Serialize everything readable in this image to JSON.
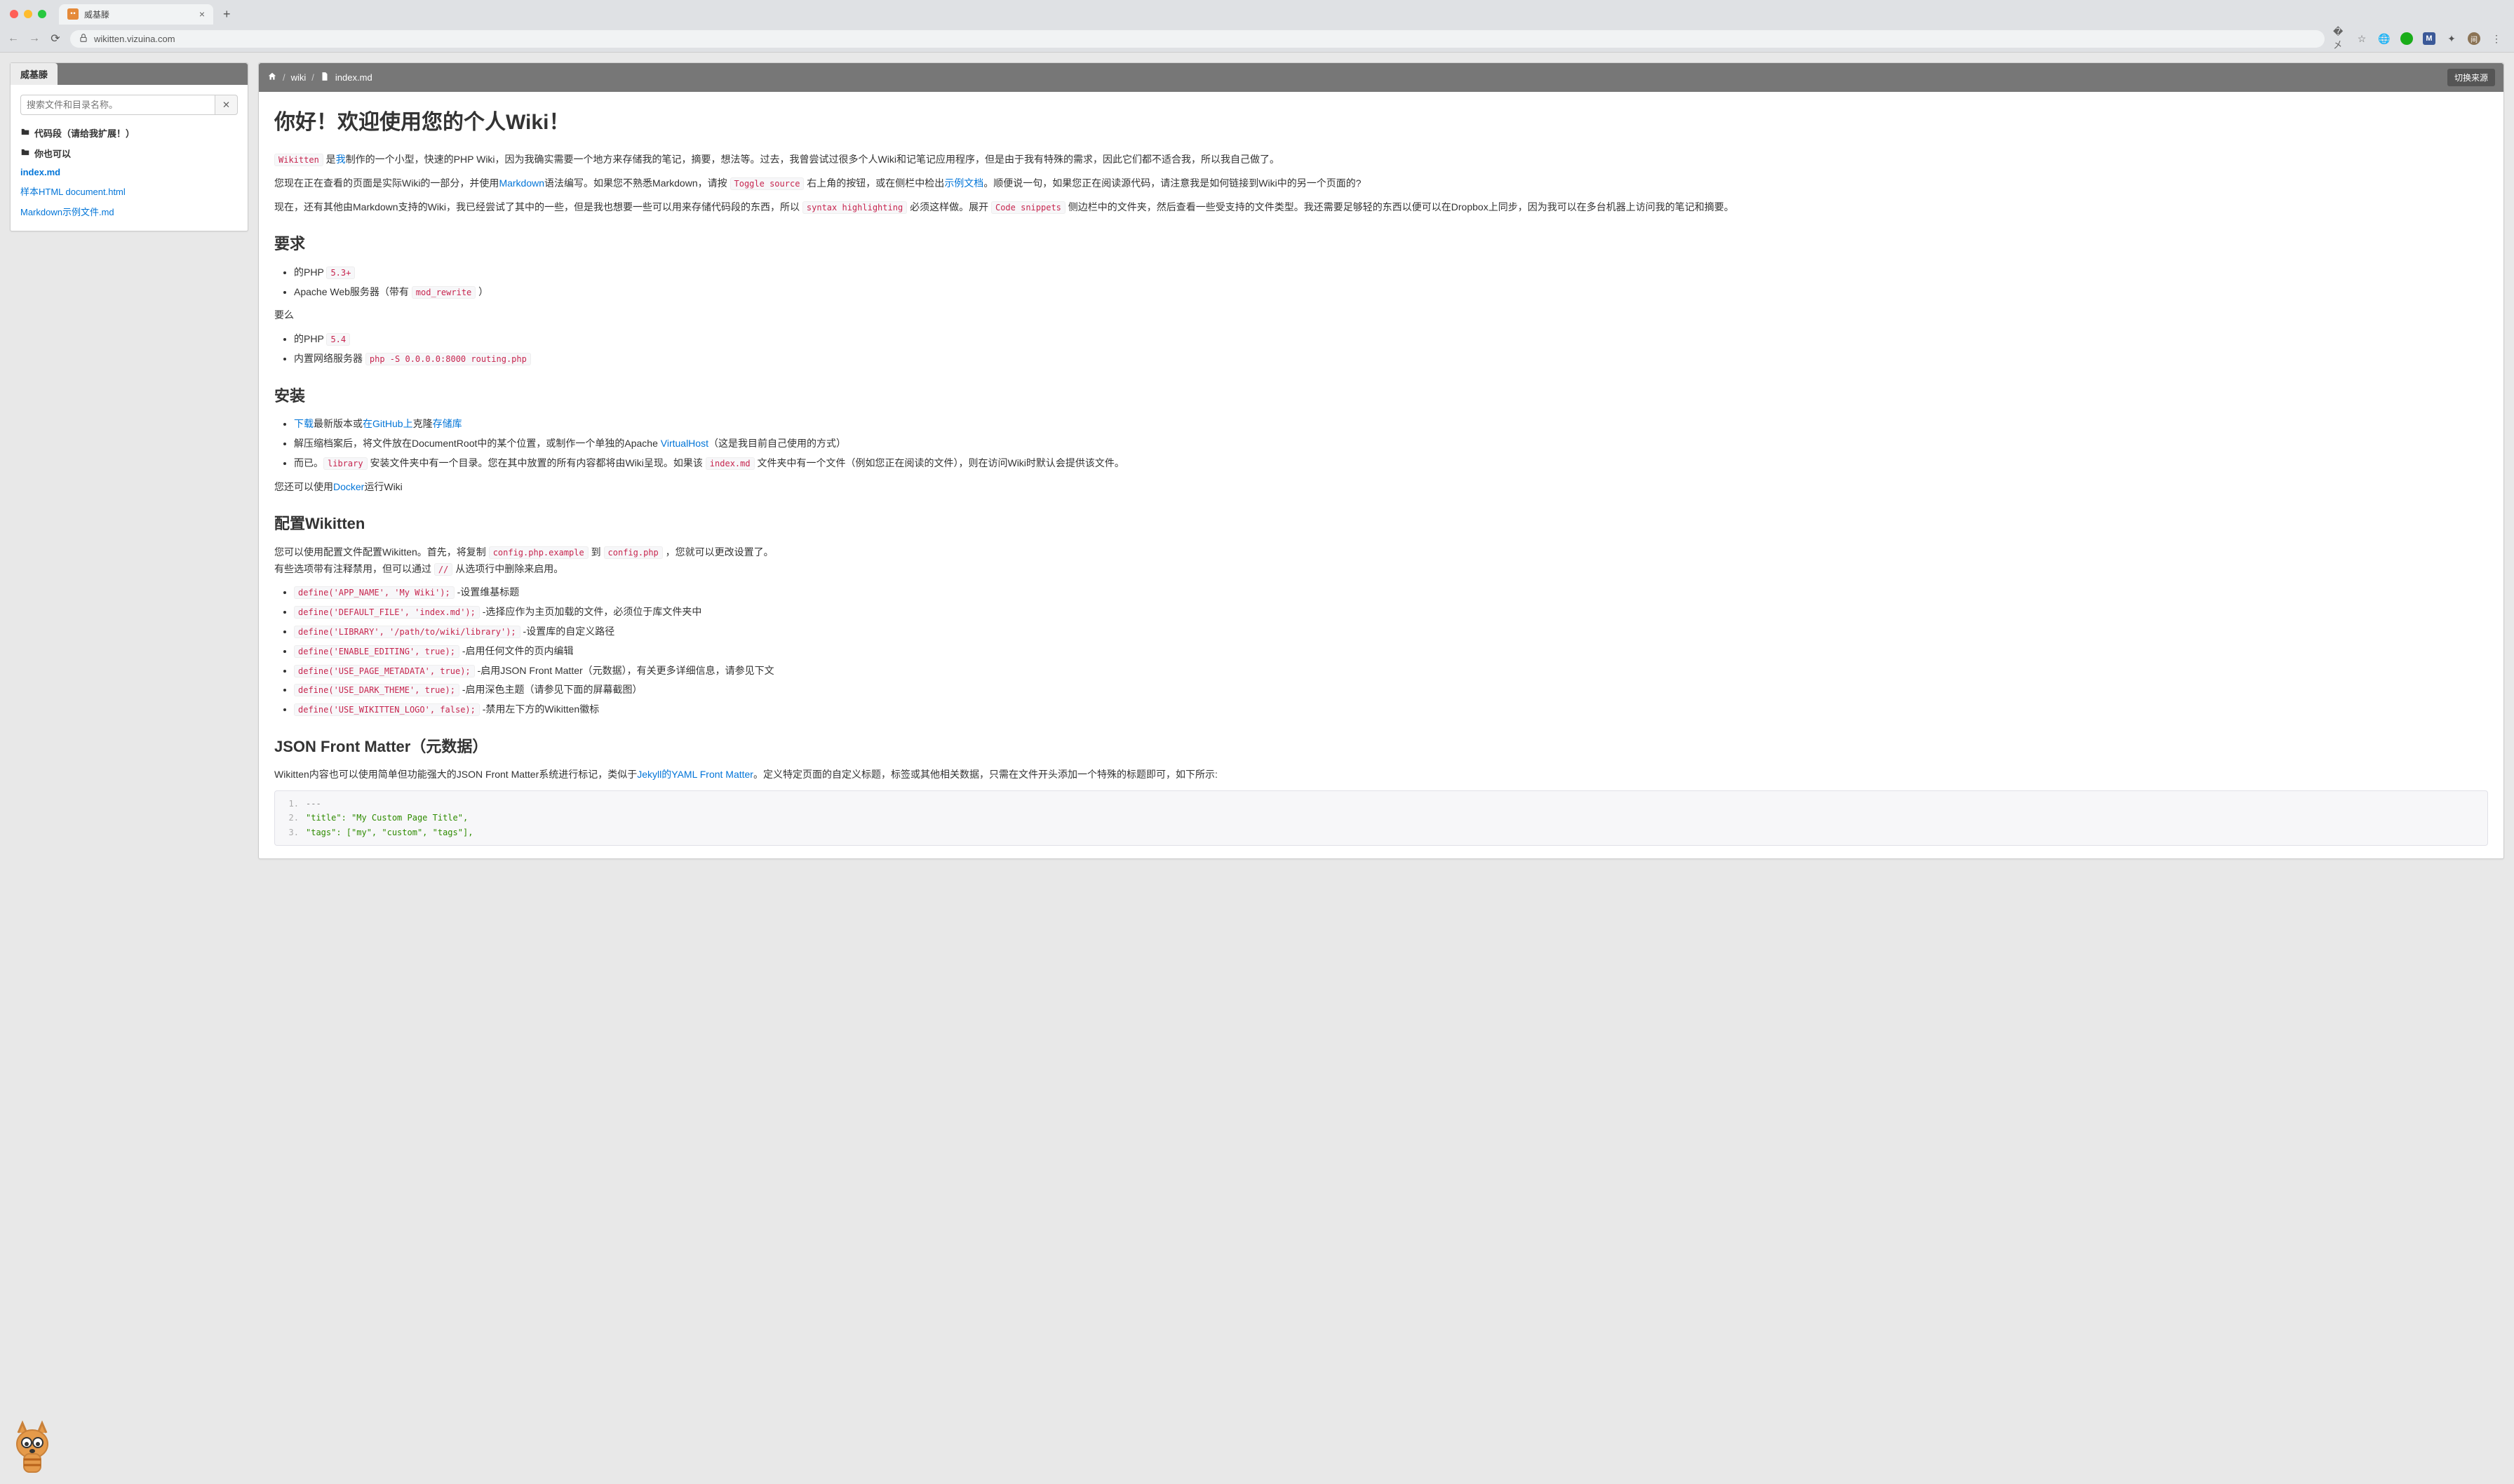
{
  "browser": {
    "tab_title": "威基滕",
    "url_display": "wikitten.vizuina.com",
    "nav": {
      "translate": "⤧",
      "star": "☆"
    }
  },
  "sidebar": {
    "tab_label": "威基滕",
    "search_placeholder": "搜索文件和目录名称。",
    "clear_icon": "✕",
    "items": [
      {
        "type": "folder",
        "label": "代码段（请给我扩展！）"
      },
      {
        "type": "folder",
        "label": "你也可以"
      },
      {
        "type": "file-active",
        "label": "index.md"
      },
      {
        "type": "file-link",
        "label": "样本HTML document.html"
      },
      {
        "type": "file-link",
        "label": "Markdown示例文件.md"
      }
    ]
  },
  "breadcrumb": {
    "wiki": "wiki",
    "file": "index.md",
    "toggle": "切换来源"
  },
  "doc": {
    "h1": "你好！欢迎使用您的个人Wiki！",
    "p1_a": "Wikitten",
    "p1_b": " 是",
    "p1_me": "我",
    "p1_c": "制作的一个小型，快速的PHP Wiki，因为我确实需要一个地方来存储我的笔记，摘要，想法等。过去，我曾尝试过很多个人Wiki和记笔记应用程序，但是由于我有特殊的需求，因此它们都不适合我，所以我自己做了。",
    "p2_a": "您现在正在查看的页面是实际Wiki的一部分，并使用",
    "p2_md": "Markdown",
    "p2_b": "语法编写。如果您不熟悉Markdown，请按 ",
    "p2_code": "Toggle source",
    "p2_c": " 右上角的按钮，或在侧栏中检出",
    "p2_ex": "示例文档",
    "p2_d": "。顺便说一句，如果您正在阅读源代码，请注意我是如何链接到Wiki中的另一个页面的?",
    "p3_a": "现在，还有其他由Markdown支持的Wiki，我已经尝试了其中的一些，但是我也想要一些可以用来存储代码段的东西，所以 ",
    "p3_c1": "syntax highlighting",
    "p3_b": " 必须这样做。展开 ",
    "p3_c2": "Code snippets",
    "p3_c": " 侧边栏中的文件夹，然后查看一些受支持的文件类型。我还需要足够轻的东西以便可以在Dropbox上同步，因为我可以在多台机器上访问我的笔记和摘要。",
    "h2_req": "要求",
    "req1_a": "的PHP ",
    "req1_code": "5.3+",
    "req2_a": "Apache Web服务器（带有 ",
    "req2_code": "mod_rewrite",
    "req2_b": " ）",
    "or": "要么",
    "req3_a": "的PHP ",
    "req3_code": "5.4",
    "req4_a": "内置网络服务器 ",
    "req4_code": "php -S 0.0.0.0:8000 routing.php",
    "h2_install": "安装",
    "inst1_dl": "下载",
    "inst1_a": "最新版本或",
    "inst1_gh": "在GitHub上",
    "inst1_b": "克隆",
    "inst1_repo": "存储库",
    "inst2_a": "解压缩档案后，将文件放在DocumentRoot中的某个位置，或制作一个单独的Apache ",
    "inst2_vh": "VirtualHost",
    "inst2_b": "（这是我目前自己使用的方式）",
    "inst3_a": "而已。",
    "inst3_c1": "library",
    "inst3_b": " 安装文件夹中有一个目录。您在其中放置的所有内容都将由Wiki呈现。如果该 ",
    "inst3_c2": "index.md",
    "inst3_c": " 文件夹中有一个文件（例如您正在阅读的文件），则在访问Wiki时默认会提供该文件。",
    "p_docker_a": "您还可以使用",
    "p_docker_link": "Docker",
    "p_docker_b": "运行Wiki",
    "h2_config": "配置Wikitten",
    "cfg_p1_a": "您可以使用配置文件配置Wikitten。首先，将复制 ",
    "cfg_c1": "config.php.example",
    "cfg_p1_b": " 到 ",
    "cfg_c2": "config.php",
    "cfg_p1_c": " ，您就可以更改设置了。",
    "cfg_p2_a": "有些选项带有注释禁用，但可以通过 ",
    "cfg_c3": "//",
    "cfg_p2_b": " 从选项行中删除来启用。",
    "cfg_li": [
      {
        "code": "define('APP_NAME', 'My Wiki');",
        "desc": " -设置维基标题"
      },
      {
        "code": "define('DEFAULT_FILE', 'index.md');",
        "desc": " -选择应作为主页加载的文件，必须位于库文件夹中"
      },
      {
        "code": "define('LIBRARY', '/path/to/wiki/library');",
        "desc": " -设置库的自定义路径"
      },
      {
        "code": "define('ENABLE_EDITING', true);",
        "desc": " -启用任何文件的页内编辑"
      },
      {
        "code": "define('USE_PAGE_METADATA', true);",
        "desc": " -启用JSON Front Matter（元数据），有关更多详细信息，请参见下文"
      },
      {
        "code": "define('USE_DARK_THEME', true);",
        "desc": " -启用深色主题（请参见下面的屏幕截图）"
      },
      {
        "code": "define('USE_WIKITTEN_LOGO', false);",
        "desc": " -禁用左下方的Wikitten徽标"
      }
    ],
    "h2_json": "JSON Front Matter（元数据）",
    "json_p_a": "Wikitten内容也可以使用简单但功能强大的JSON Front Matter系统进行标记，类似于",
    "json_p_link": "Jekyll的YAML Front Matter",
    "json_p_b": "。定义特定页面的自定义标题，标签或其他相关数据，只需在文件开头添加一个特殊的标题即可，如下所示:",
    "codeblock": [
      {
        "n": "1.",
        "t": "---"
      },
      {
        "n": "2.",
        "t": "\"title\": \"My Custom Page Title\","
      },
      {
        "n": "3.",
        "t": "\"tags\": [\"my\", \"custom\", \"tags\"],"
      }
    ]
  }
}
